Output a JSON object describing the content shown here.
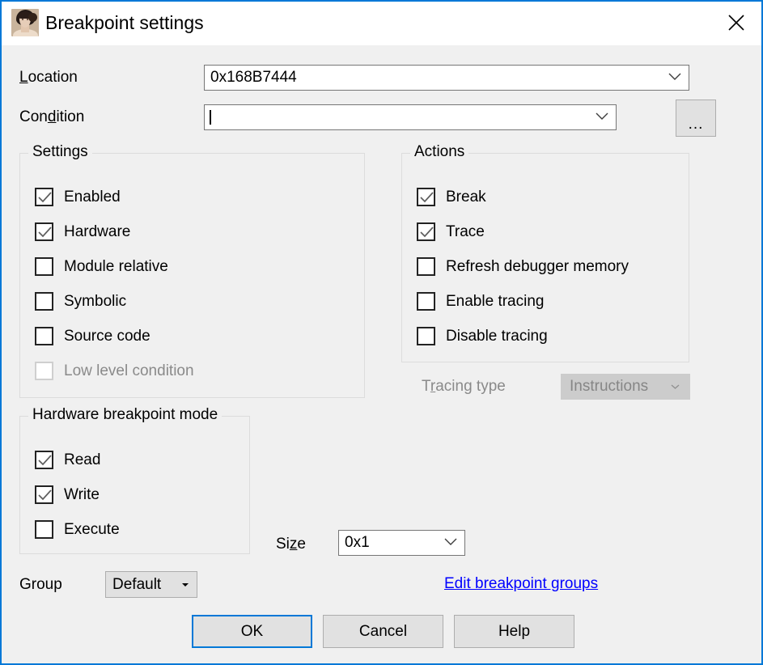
{
  "window": {
    "title": "Breakpoint settings",
    "icon": "portrait-icon",
    "close_icon": "close-icon",
    "border_color": "#0078d7",
    "background_color": "#f0f0f0"
  },
  "fields": {
    "location": {
      "label": "Location",
      "accel": "L",
      "value": "0x168B7444",
      "icon": "chevron-down-icon"
    },
    "condition": {
      "label_before": "Con",
      "label_accel": "d",
      "label_after": "ition",
      "label_full": "Condition",
      "value": "",
      "placeholder": "",
      "icon": "chevron-down-icon"
    },
    "browse": {
      "label": "...",
      "tooltip": "Browse"
    }
  },
  "settings_group": {
    "title": "Settings",
    "items": [
      {
        "label": "Enabled",
        "checked": true,
        "disabled": false
      },
      {
        "label": "Hardware",
        "checked": true,
        "disabled": false
      },
      {
        "label": "Module relative",
        "checked": false,
        "disabled": false
      },
      {
        "label": "Symbolic",
        "checked": false,
        "disabled": false
      },
      {
        "label": "Source code",
        "checked": false,
        "disabled": false
      },
      {
        "label": "Low level condition",
        "checked": false,
        "disabled": true
      }
    ]
  },
  "actions_group": {
    "title": "Actions",
    "items": [
      {
        "label": "Break",
        "checked": true,
        "disabled": false
      },
      {
        "label": "Trace",
        "checked": true,
        "disabled": false
      },
      {
        "label": "Refresh debugger memory",
        "checked": false,
        "disabled": false
      },
      {
        "label": "Enable tracing",
        "checked": false,
        "disabled": false
      },
      {
        "label": "Disable tracing",
        "checked": false,
        "disabled": false
      }
    ]
  },
  "tracing_type": {
    "label_before": "T",
    "label_accel": "r",
    "label_after": "acing type",
    "label_full": "Tracing type",
    "value": "Instructions",
    "disabled": true,
    "icon": "chevron-down-icon"
  },
  "hardware_group": {
    "title": "Hardware breakpoint mode",
    "items": [
      {
        "label": "Read",
        "checked": true,
        "disabled": false
      },
      {
        "label": "Write",
        "checked": true,
        "disabled": false
      },
      {
        "label": "Execute",
        "checked": false,
        "disabled": false
      }
    ]
  },
  "size": {
    "label_before": "Si",
    "label_accel": "z",
    "label_after": "e",
    "label_full": "Size",
    "value": "0x1",
    "icon": "chevron-down-icon"
  },
  "group": {
    "label": "Group",
    "value": "Default",
    "icon": "triangle-down-icon"
  },
  "link": {
    "label": "Edit breakpoint groups",
    "color": "#0000ff"
  },
  "buttons": {
    "ok": "OK",
    "cancel": "Cancel",
    "help": "Help",
    "default_focus": "ok",
    "focus_color": "#0078d7"
  }
}
